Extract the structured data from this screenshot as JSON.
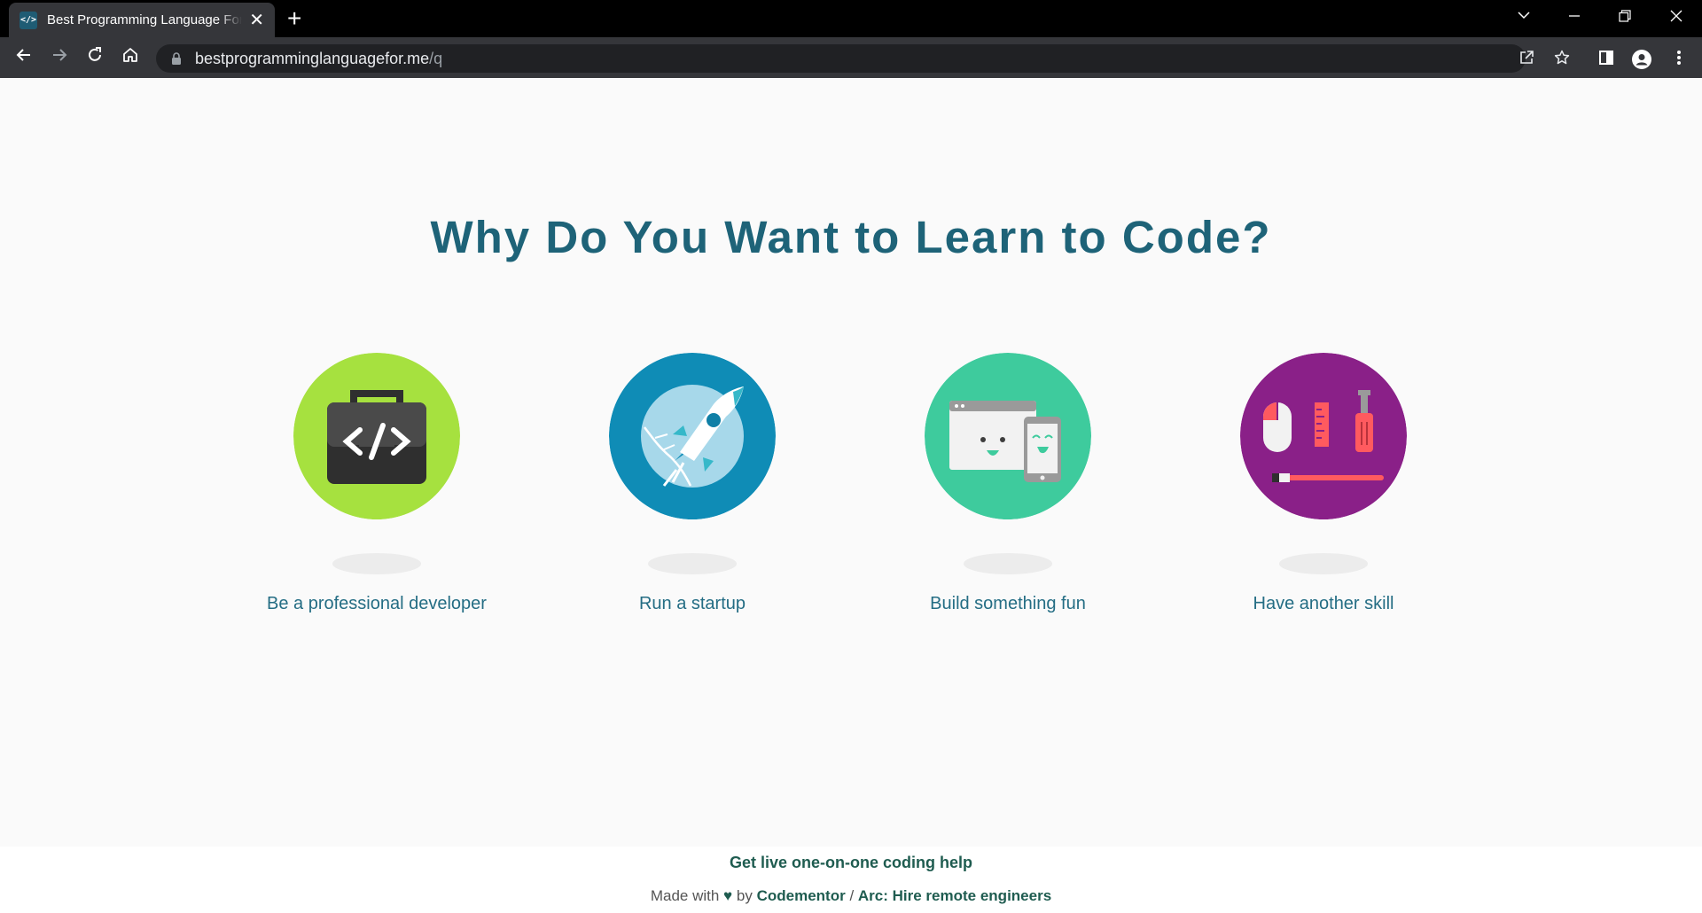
{
  "browser": {
    "tab_title": "Best Programming Language For Me",
    "tab_favicon": "</>",
    "url_host": "bestprogramminglanguagefor.me",
    "url_path": "/q"
  },
  "page": {
    "title": "Why Do You Want to Learn to Code?",
    "options": [
      {
        "label": "Be a professional developer",
        "icon": "briefcase-code-icon",
        "color": "#a6e13f"
      },
      {
        "label": "Run a startup",
        "icon": "rocket-icon",
        "color": "#0f8cb6"
      },
      {
        "label": "Build something fun",
        "icon": "browser-phone-icon",
        "color": "#3ecb9d"
      },
      {
        "label": "Have another skill",
        "icon": "tools-icon",
        "color": "#8a2088"
      }
    ]
  },
  "footer": {
    "help_link": "Get live one-on-one coding help",
    "made_with": "Made with",
    "heart": "♥",
    "by": "by",
    "codementor": "Codementor",
    "separator": "/",
    "arc": "Arc: Hire remote engineers"
  }
}
